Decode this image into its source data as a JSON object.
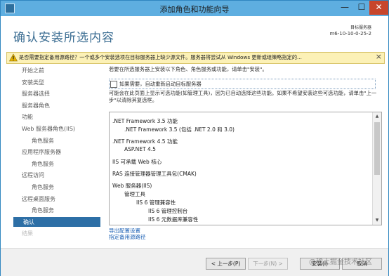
{
  "window": {
    "title": "添加角色和功能向导",
    "minimize": "—",
    "maximize": "☐",
    "close": "✕"
  },
  "header": {
    "page_title": "确认安装所选内容",
    "destination_label": "目标服务器",
    "destination_value": "m6-10-10-0-25-2"
  },
  "warning": {
    "text": "是否需要指定备用源路径？一个或多个安装选项在目标服务器上缺少源文件。服务器将尝试从 Windows 更新或组策略指定的...",
    "close": "×"
  },
  "nav": {
    "items": [
      {
        "label": "开始之前",
        "indent": 0,
        "state": "normal"
      },
      {
        "label": "安装类型",
        "indent": 0,
        "state": "normal"
      },
      {
        "label": "服务器选择",
        "indent": 0,
        "state": "normal"
      },
      {
        "label": "服务器角色",
        "indent": 0,
        "state": "normal"
      },
      {
        "label": "功能",
        "indent": 0,
        "state": "normal"
      },
      {
        "label": "Web 服务器角色(IIS)",
        "indent": 0,
        "state": "normal"
      },
      {
        "label": "角色服务",
        "indent": 1,
        "state": "normal"
      },
      {
        "label": "应用程序服务器",
        "indent": 0,
        "state": "normal"
      },
      {
        "label": "角色服务",
        "indent": 1,
        "state": "normal"
      },
      {
        "label": "远程访问",
        "indent": 0,
        "state": "normal"
      },
      {
        "label": "角色服务",
        "indent": 1,
        "state": "normal"
      },
      {
        "label": "远程桌面服务",
        "indent": 0,
        "state": "normal"
      },
      {
        "label": "角色服务",
        "indent": 1,
        "state": "normal"
      },
      {
        "label": "确认",
        "indent": 0,
        "state": "active"
      },
      {
        "label": "结果",
        "indent": 0,
        "state": "disabled"
      }
    ]
  },
  "content": {
    "intro": "若要在所选服务器上安装以下角色、角色服务或功能，请单击\"安装\"。",
    "restart_checkbox_label": "如果需要，自动重新启动目标服务器",
    "restart_checked": false,
    "note": "可能会在此页面上显示可选功能(如管理工具)，因为已自动选择这些功能。如果不希望安装这些可选功能，请单击\"上一步\"以清除其复选框。",
    "list_items": [
      {
        "text": ".NET Framework 3.5 功能",
        "level": 0,
        "gap": false
      },
      {
        "text": ".NET Framework 3.5 (包括 .NET 2.0 和 3.0)",
        "level": 1,
        "gap": false
      },
      {
        "text": ".NET Framework 4.5 功能",
        "level": 0,
        "gap": true
      },
      {
        "text": "ASP.NET 4.5",
        "level": 1,
        "gap": false
      },
      {
        "text": "IIS 可承载 Web 核心",
        "level": 0,
        "gap": true
      },
      {
        "text": "RAS 连接管理器管理工具包(CMAK)",
        "level": 0,
        "gap": true
      },
      {
        "text": "Web 服务器(IIS)",
        "level": 0,
        "gap": true
      },
      {
        "text": "管理工具",
        "level": 1,
        "gap": false
      },
      {
        "text": "IIS 6 管理兼容性",
        "level": 2,
        "gap": false
      },
      {
        "text": "IIS 6 管理控制台",
        "level": 3,
        "gap": false
      },
      {
        "text": "IIS 6 元数据库兼容性",
        "level": 3,
        "gap": false
      }
    ],
    "links": [
      "导出配置设置",
      "指定备用源路径"
    ]
  },
  "footer": {
    "prev_label": "< 上一步(P)",
    "next_label": "下一步(N) >",
    "install_label": "安装(I)",
    "cancel_label": "取消"
  },
  "watermark": "@稀土掘金技术社区"
}
